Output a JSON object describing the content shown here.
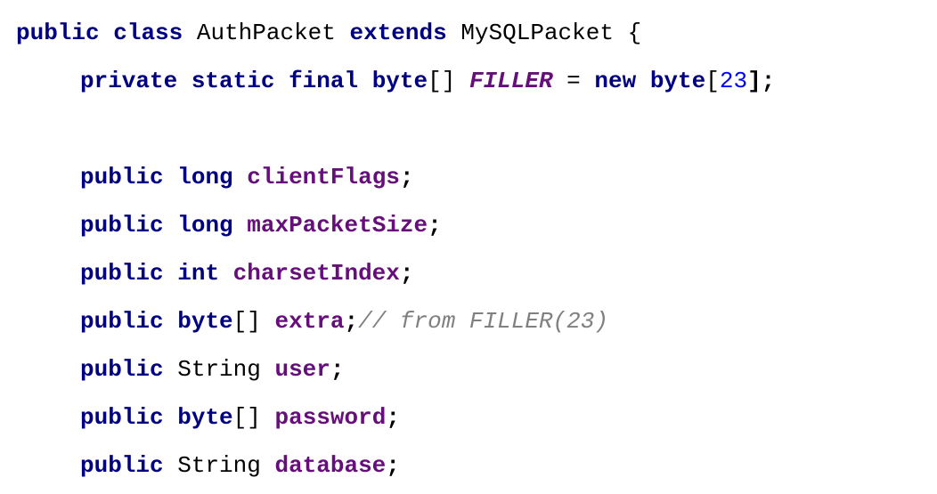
{
  "code": {
    "line1": {
      "kw_public": "public",
      "kw_class": "class",
      "class_name": "AuthPacket",
      "kw_extends": "extends",
      "super_name": "MySQLPacket",
      "brace": "{"
    },
    "line2": {
      "kw_private": "private",
      "kw_static": "static",
      "kw_final": "final",
      "kw_byte": "byte",
      "brackets": "[]",
      "field": "FILLER",
      "op": "=",
      "kw_new": "new",
      "kw_byte2": "byte",
      "open": "[",
      "size": "23",
      "close": "];"
    },
    "line3": {
      "kw_public": "public",
      "kw_type": "long",
      "field": "clientFlags",
      "semi": ";"
    },
    "line4": {
      "kw_public": "public",
      "kw_type": "long",
      "field": "maxPacketSize",
      "semi": ";"
    },
    "line5": {
      "kw_public": "public",
      "kw_type": "int",
      "field": "charsetIndex",
      "semi": ";"
    },
    "line6": {
      "kw_public": "public",
      "kw_type": "byte",
      "brackets": "[]",
      "field": "extra",
      "semi": ";",
      "comment": "// from FILLER(23)"
    },
    "line7": {
      "kw_public": "public",
      "type": "String",
      "field": "user",
      "semi": ";"
    },
    "line8": {
      "kw_public": "public",
      "kw_type": "byte",
      "brackets": "[]",
      "field": "password",
      "semi": ";"
    },
    "line9": {
      "kw_public": "public",
      "type": "String",
      "field": "database",
      "semi": ";"
    }
  }
}
